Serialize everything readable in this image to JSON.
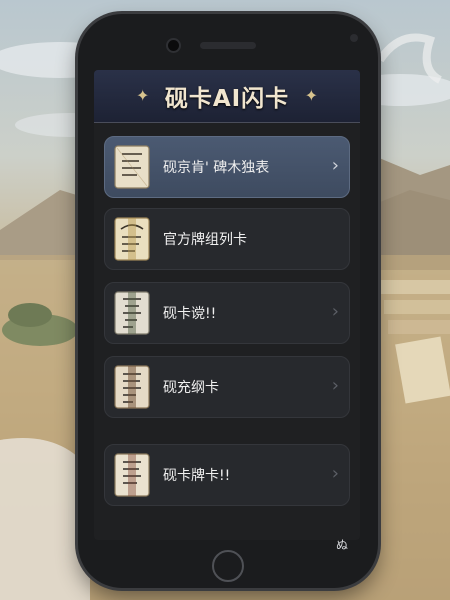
{
  "app": {
    "title": "砚卡AI闪卡"
  },
  "menu": {
    "items": [
      {
        "label": "砚京肯' 碑木独表",
        "icon": "scroll-card-icon",
        "active": true,
        "chevron": true
      },
      {
        "label": "官方牌组列卡",
        "icon": "scroll-card-icon",
        "active": false,
        "chevron": false
      },
      {
        "label": "砚卡谠!!",
        "icon": "scroll-card-icon",
        "active": false,
        "chevron": true
      },
      {
        "label": "砚充纲卡",
        "icon": "scroll-card-icon",
        "active": false,
        "chevron": true
      },
      {
        "label": "砚卡牌卡!!",
        "icon": "scroll-card-icon",
        "active": false,
        "chevron": true
      }
    ],
    "chevron_glyph": "›"
  },
  "device": {
    "corner_glyph": "ぬ"
  },
  "colors": {
    "header_bg": "#2a3148",
    "active_item": "#4b5a72",
    "item_bg": "#27292d",
    "title_text": "#f1e6cf",
    "scene_sky": "#b9c7cf",
    "scene_sand": "#c3ac84"
  }
}
